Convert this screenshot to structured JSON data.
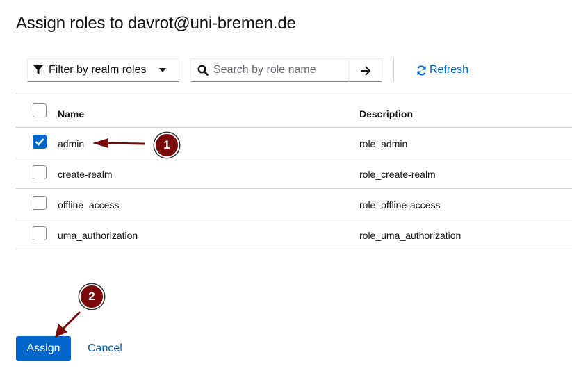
{
  "page": {
    "title": "Assign roles to davrot@uni-bremen.de"
  },
  "toolbar": {
    "filter_label": "Filter by realm roles",
    "filter_icon": "filter-icon",
    "search_placeholder": "Search by role name",
    "search_value": "",
    "search_icon": "search-icon",
    "search_go_icon": "arrow-right-icon",
    "refresh_label": "Refresh",
    "refresh_icon": "sync-icon"
  },
  "table": {
    "columns": [
      "Name",
      "Description"
    ],
    "rows": [
      {
        "name": "admin",
        "description": "role_admin",
        "checked": true
      },
      {
        "name": "create-realm",
        "description": "role_create-realm",
        "checked": false
      },
      {
        "name": "offline_access",
        "description": "role_offline-access",
        "checked": false
      },
      {
        "name": "uma_authorization",
        "description": "role_uma_authorization",
        "checked": false
      }
    ]
  },
  "actions": {
    "assign_label": "Assign",
    "cancel_label": "Cancel"
  },
  "annotations": {
    "callout_1": "1",
    "callout_2": "2",
    "color": "#7a0a0a"
  },
  "colors": {
    "primary": "#0066cc",
    "text": "#151515",
    "border": "#d2d2d2"
  }
}
